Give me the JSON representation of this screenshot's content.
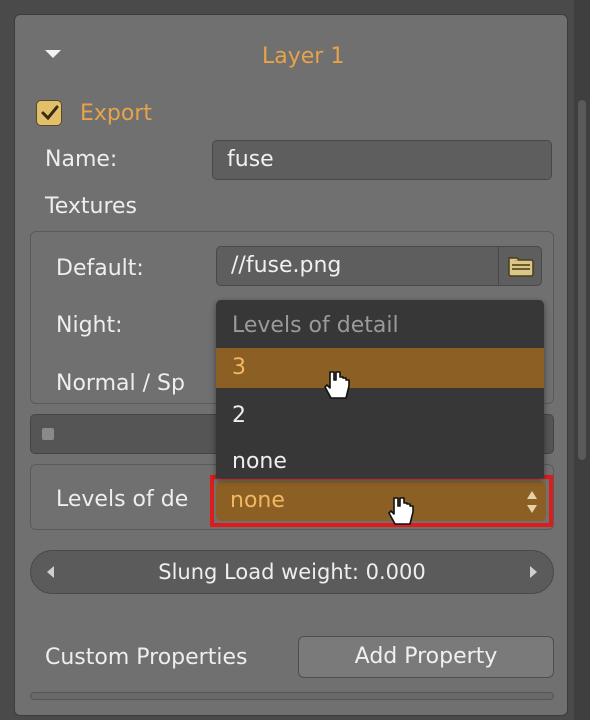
{
  "panel": {
    "layer_title": "Layer 1",
    "export_label": "Export",
    "export_checked": true,
    "name_label": "Name:",
    "name_value": "fuse",
    "textures_label": "Textures",
    "default_label": "Default:",
    "default_value": "//fuse.png",
    "night_label": "Night:",
    "normal_label": "Normal / Sp",
    "lod_label": "Levels of de",
    "lod_value": "none",
    "slider_text": "Slung Load weight: 0.000",
    "custom_props_label": "Custom Properties",
    "add_property_label": "Add Property"
  },
  "dropdown": {
    "header": "Levels of detail",
    "options": [
      "3",
      "2",
      "none"
    ],
    "highlighted": "3"
  },
  "icons": {
    "collapse": "triangle-down-icon",
    "folder": "folder-icon",
    "checkbox": "checkbox-checked-icon",
    "cursor": "hand-pointer-icon"
  },
  "colors": {
    "accent": "#e8a34a",
    "selection": "#8c5f24",
    "highlight_box": "#dd1c1c"
  }
}
